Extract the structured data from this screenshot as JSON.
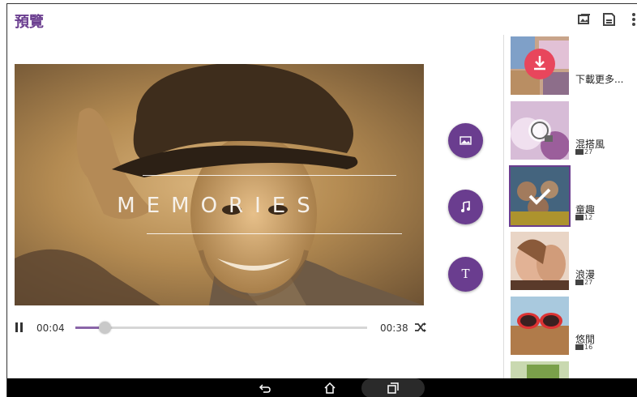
{
  "header": {
    "title": "預覽",
    "icons": [
      "add-photo-icon",
      "save-icon",
      "overflow-menu-icon"
    ]
  },
  "video": {
    "overlay_text": "MEMORIES"
  },
  "player": {
    "current_time": "00:04",
    "total_time": "00:38",
    "progress": 0.1
  },
  "fabs": [
    "image-icon",
    "music-icon",
    "text-icon"
  ],
  "fab_text_label": "T",
  "themes": {
    "download_label": "下載更多...",
    "items": [
      {
        "name": "混搭風",
        "count": "27"
      },
      {
        "name": "童趣",
        "count": "12",
        "selected": true
      },
      {
        "name": "浪漫",
        "count": "27"
      },
      {
        "name": "悠閒",
        "count": "16"
      }
    ]
  },
  "colors": {
    "accent": "#6a3d8f",
    "download": "#e8465c"
  }
}
